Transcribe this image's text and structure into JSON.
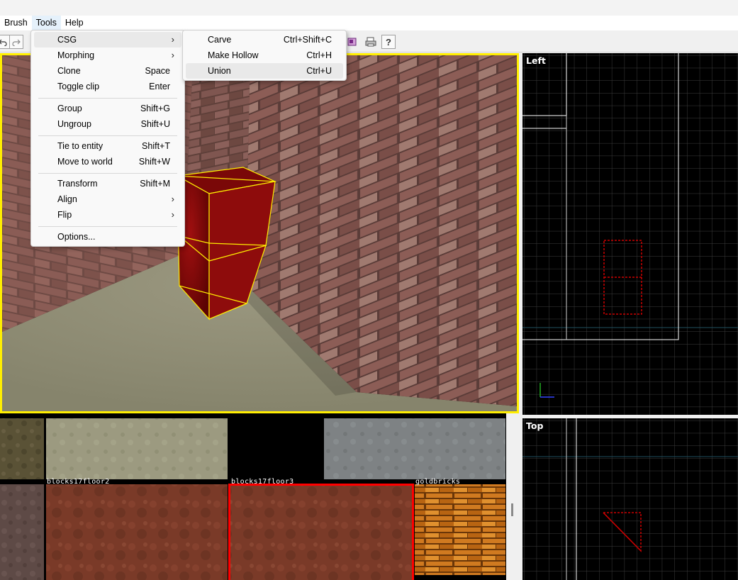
{
  "menubar": {
    "items": [
      "Brush",
      "Tools",
      "Help"
    ]
  },
  "tools_menu": {
    "items": [
      {
        "label": "CSG",
        "shortcut": "",
        "submenu": true
      },
      {
        "label": "Morphing",
        "shortcut": "",
        "submenu": true
      },
      {
        "label": "Clone",
        "shortcut": "Space",
        "submenu": false
      },
      {
        "label": "Toggle clip",
        "shortcut": "Enter",
        "submenu": false
      },
      {
        "label": "Group",
        "shortcut": "Shift+G",
        "submenu": false
      },
      {
        "label": "Ungroup",
        "shortcut": "Shift+U",
        "submenu": false
      },
      {
        "label": "Tie to entity",
        "shortcut": "Shift+T",
        "submenu": false
      },
      {
        "label": "Move to world",
        "shortcut": "Shift+W",
        "submenu": false
      },
      {
        "label": "Transform",
        "shortcut": "Shift+M",
        "submenu": false
      },
      {
        "label": "Align",
        "shortcut": "",
        "submenu": true
      },
      {
        "label": "Flip",
        "shortcut": "",
        "submenu": true
      },
      {
        "label": "Options...",
        "shortcut": "",
        "submenu": false
      }
    ],
    "submenu_arrow": "›"
  },
  "csg_submenu": {
    "items": [
      {
        "label": "Carve",
        "shortcut": "Ctrl+Shift+C"
      },
      {
        "label": "Make Hollow",
        "shortcut": "Ctrl+H"
      },
      {
        "label": "Union",
        "shortcut": "Ctrl+U"
      }
    ],
    "highlighted": "Union"
  },
  "toolbar": {
    "icons": [
      "undo-icon",
      "redo-icon",
      "texture-lock-icon",
      "print-icon",
      "help-icon"
    ],
    "help_glyph": "?"
  },
  "viewports": {
    "left_label": "Left",
    "top_label": "Top",
    "selection_color": "#ffee00",
    "brush_color": "#cc0000"
  },
  "textures": {
    "labels": [
      "blocks17floor2",
      "blocks17floor3",
      "goldbricks"
    ],
    "selected": "blocks17floor3",
    "selection_color": "#ff0000"
  }
}
